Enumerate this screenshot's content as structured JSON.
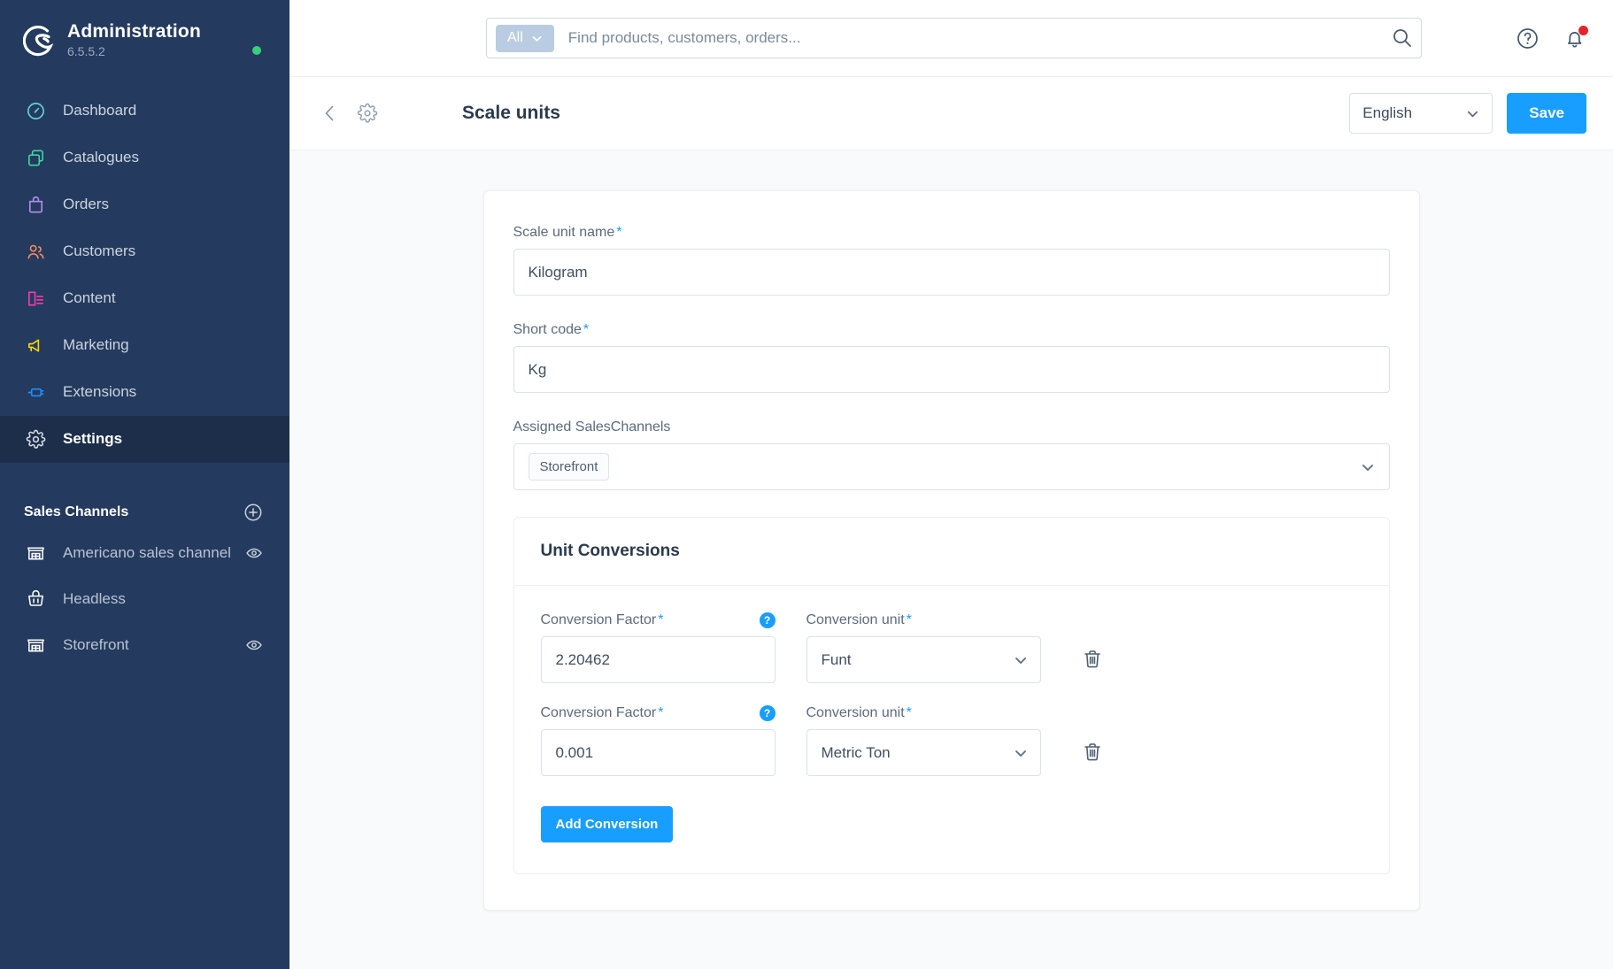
{
  "sidebar": {
    "brand": {
      "title": "Administration",
      "version": "6.5.5.2",
      "logo_icon": "shopware-logo",
      "status_dot": "online-status-dot"
    },
    "items": [
      {
        "label": "Dashboard",
        "icon": "dashboard-icon",
        "color": "#61d4d3",
        "active": false
      },
      {
        "label": "Catalogues",
        "icon": "catalogues-icon",
        "color": "#3fd6a0",
        "active": false
      },
      {
        "label": "Orders",
        "icon": "orders-icon",
        "color": "#b48dec",
        "active": false
      },
      {
        "label": "Customers",
        "icon": "customers-icon",
        "color": "#f38a5c",
        "active": false
      },
      {
        "label": "Content",
        "icon": "content-icon",
        "color": "#f33daf",
        "active": false
      },
      {
        "label": "Marketing",
        "icon": "marketing-icon",
        "color": "#ffd700",
        "active": false
      },
      {
        "label": "Extensions",
        "icon": "extensions-icon",
        "color": "#1e90ff",
        "active": false
      },
      {
        "label": "Settings",
        "icon": "settings-gear-icon",
        "color": "#d8dfe5",
        "active": true
      }
    ],
    "sales_channels": {
      "title": "Sales Channels",
      "add_icon": "plus-circle-icon",
      "items": [
        {
          "label": "Americano sales channel",
          "icon": "storefront-icon",
          "has_eye": true
        },
        {
          "label": "Headless",
          "icon": "basket-icon",
          "has_eye": false
        },
        {
          "label": "Storefront",
          "icon": "storefront-icon",
          "has_eye": true
        }
      ]
    }
  },
  "topbar": {
    "search": {
      "scope_label": "All",
      "scope_caret_icon": "chevron-down-icon",
      "placeholder": "Find products, customers, orders...",
      "value": "",
      "search_icon": "search-icon"
    },
    "help_icon": "help-circle-icon",
    "notifications_icon": "bell-icon",
    "has_notification": true
  },
  "pagehead": {
    "back_icon": "chevron-left-icon",
    "gear_icon": "gear-icon",
    "title": "Scale units",
    "language": {
      "value": "English",
      "caret_icon": "chevron-down-icon"
    },
    "save_label": "Save"
  },
  "form": {
    "scale_unit_name": {
      "label": "Scale unit name",
      "required": true,
      "value": "Kilogram"
    },
    "short_code": {
      "label": "Short code",
      "required": true,
      "value": "Kg"
    },
    "assigned_sales_channels": {
      "label": "Assigned SalesChannels",
      "required": false,
      "tags": [
        "Storefront"
      ],
      "caret_icon": "chevron-down-icon"
    },
    "unit_conversions": {
      "title": "Unit Conversions",
      "factor_label": "Conversion Factor",
      "unit_label": "Conversion unit",
      "help_icon": "help-badge-icon",
      "delete_icon": "trash-icon",
      "rows": [
        {
          "factor": "2.20462",
          "unit": "Funt"
        },
        {
          "factor": "0.001",
          "unit": "Metric Ton"
        }
      ],
      "add_label": "Add Conversion"
    }
  },
  "colors": {
    "accent": "#189eff",
    "sidebar_bg": "#243a5e",
    "sidebar_active": "#1c2e4a",
    "page_bg": "#f9fafb",
    "status_green": "#37d07a",
    "notification_red": "#e52427"
  }
}
